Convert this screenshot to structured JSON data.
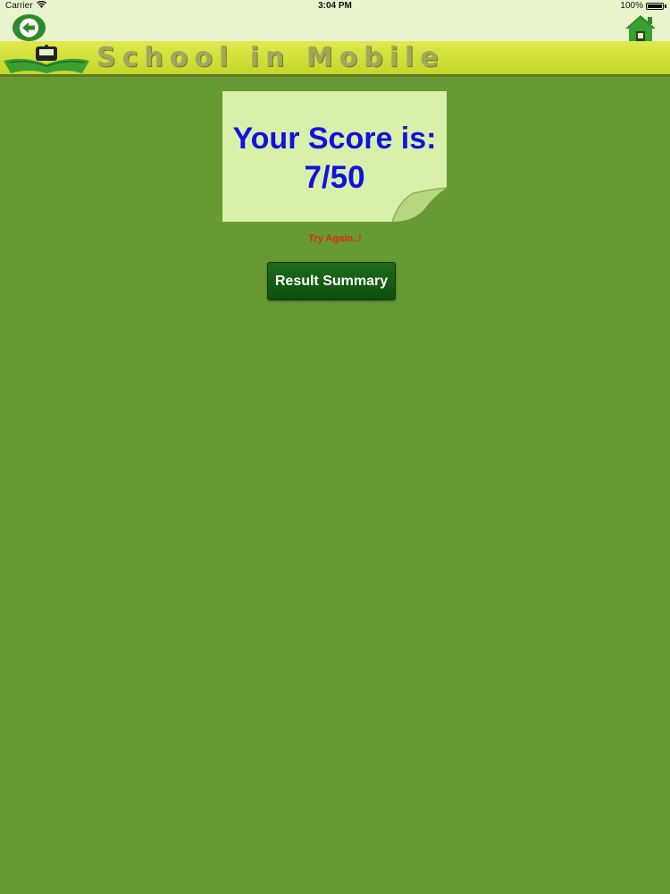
{
  "status_bar": {
    "carrier": "Carrier",
    "time": "3:04 PM",
    "battery": "100%"
  },
  "nav": {
    "back_icon": "back-arrow-icon",
    "home_icon": "home-icon"
  },
  "banner": {
    "title": "School in Mobile",
    "logo_icon": "book-logo-icon"
  },
  "score": {
    "title": "Your Score is:",
    "value": "7/50"
  },
  "feedback": "Try Again..!",
  "result_button": "Result Summary",
  "colors": {
    "background": "#689a33",
    "score_text": "#1111e0",
    "feedback_text": "#e02a10",
    "button": "#0d4f0f",
    "banner": "#d4e03a",
    "card": "#d9f0ab"
  }
}
